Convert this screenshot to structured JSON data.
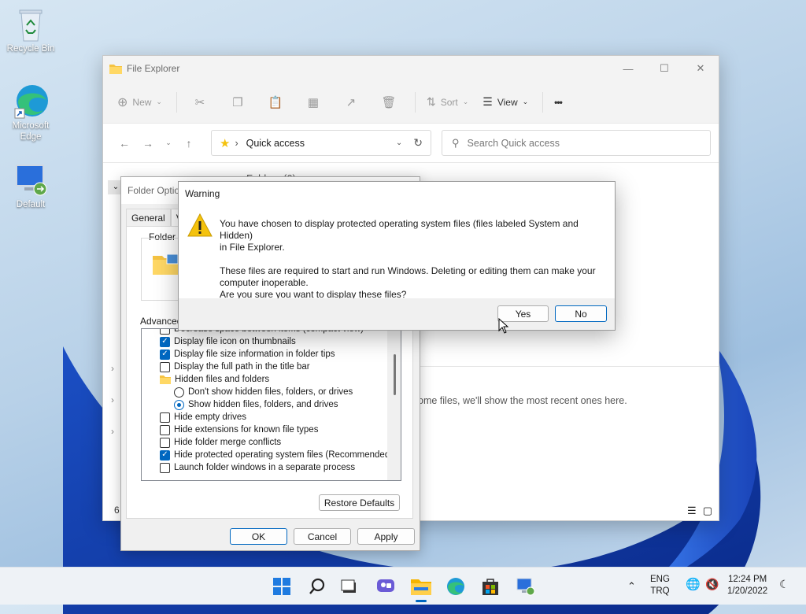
{
  "desktop": {
    "icons": [
      {
        "label": "Recycle Bin"
      },
      {
        "label": "Microsoft Edge"
      },
      {
        "label": "Default"
      }
    ]
  },
  "explorer": {
    "title": "File Explorer",
    "toolbar": {
      "new_label": "New",
      "sort_label": "Sort",
      "view_label": "View",
      "more_label": "•••"
    },
    "address": {
      "location": "Quick access"
    },
    "search": {
      "placeholder": "Search Quick access"
    },
    "empty_message": "ome files, we'll show the most recent ones here.",
    "status_count": "6",
    "hidden_header": "Folders (6)"
  },
  "folder_options": {
    "title": "Folder Optio",
    "tabs": [
      "General",
      "Vi"
    ],
    "folder_views_label": "Folder v",
    "advanced_label": "Advanced",
    "items": [
      {
        "type": "checkbox",
        "checked": false,
        "label": "Decrease space between items (compact view)",
        "indent": 0
      },
      {
        "type": "checkbox",
        "checked": true,
        "label": "Display file icon on thumbnails",
        "indent": 0
      },
      {
        "type": "checkbox",
        "checked": true,
        "label": "Display file size information in folder tips",
        "indent": 0
      },
      {
        "type": "checkbox",
        "checked": false,
        "label": "Display the full path in the title bar",
        "indent": 0
      },
      {
        "type": "folder",
        "checked": false,
        "label": "Hidden files and folders",
        "indent": 0
      },
      {
        "type": "radio",
        "checked": false,
        "label": "Don't show hidden files, folders, or drives",
        "indent": 1
      },
      {
        "type": "radio",
        "checked": true,
        "label": "Show hidden files, folders, and drives",
        "indent": 1
      },
      {
        "type": "checkbox",
        "checked": false,
        "label": "Hide empty drives",
        "indent": 0
      },
      {
        "type": "checkbox",
        "checked": false,
        "label": "Hide extensions for known file types",
        "indent": 0
      },
      {
        "type": "checkbox",
        "checked": false,
        "label": "Hide folder merge conflicts",
        "indent": 0
      },
      {
        "type": "checkbox",
        "checked": true,
        "label": "Hide protected operating system files (Recommended)",
        "indent": 0
      },
      {
        "type": "checkbox",
        "checked": false,
        "label": "Launch folder windows in a separate process",
        "indent": 0
      }
    ],
    "restore_defaults_label": "Restore Defaults",
    "ok_label": "OK",
    "cancel_label": "Cancel",
    "apply_label": "Apply"
  },
  "warning": {
    "title": "Warning",
    "line1": "You have chosen to display protected operating system files (files labeled System and Hidden)",
    "line1b": "in File Explorer.",
    "line2": "These files are required to start and run Windows. Deleting or editing them can make your",
    "line2b": "computer inoperable.",
    "line3": "Are you sure you want to display these files?",
    "yes_label": "Yes",
    "no_label": "No"
  },
  "taskbar": {
    "lang_top": "ENG",
    "lang_bottom": "TRQ",
    "time": "12:24 PM",
    "date": "1/20/2022"
  },
  "colors": {
    "accent": "#0067c0",
    "warning_yellow": "#f4c20d"
  }
}
